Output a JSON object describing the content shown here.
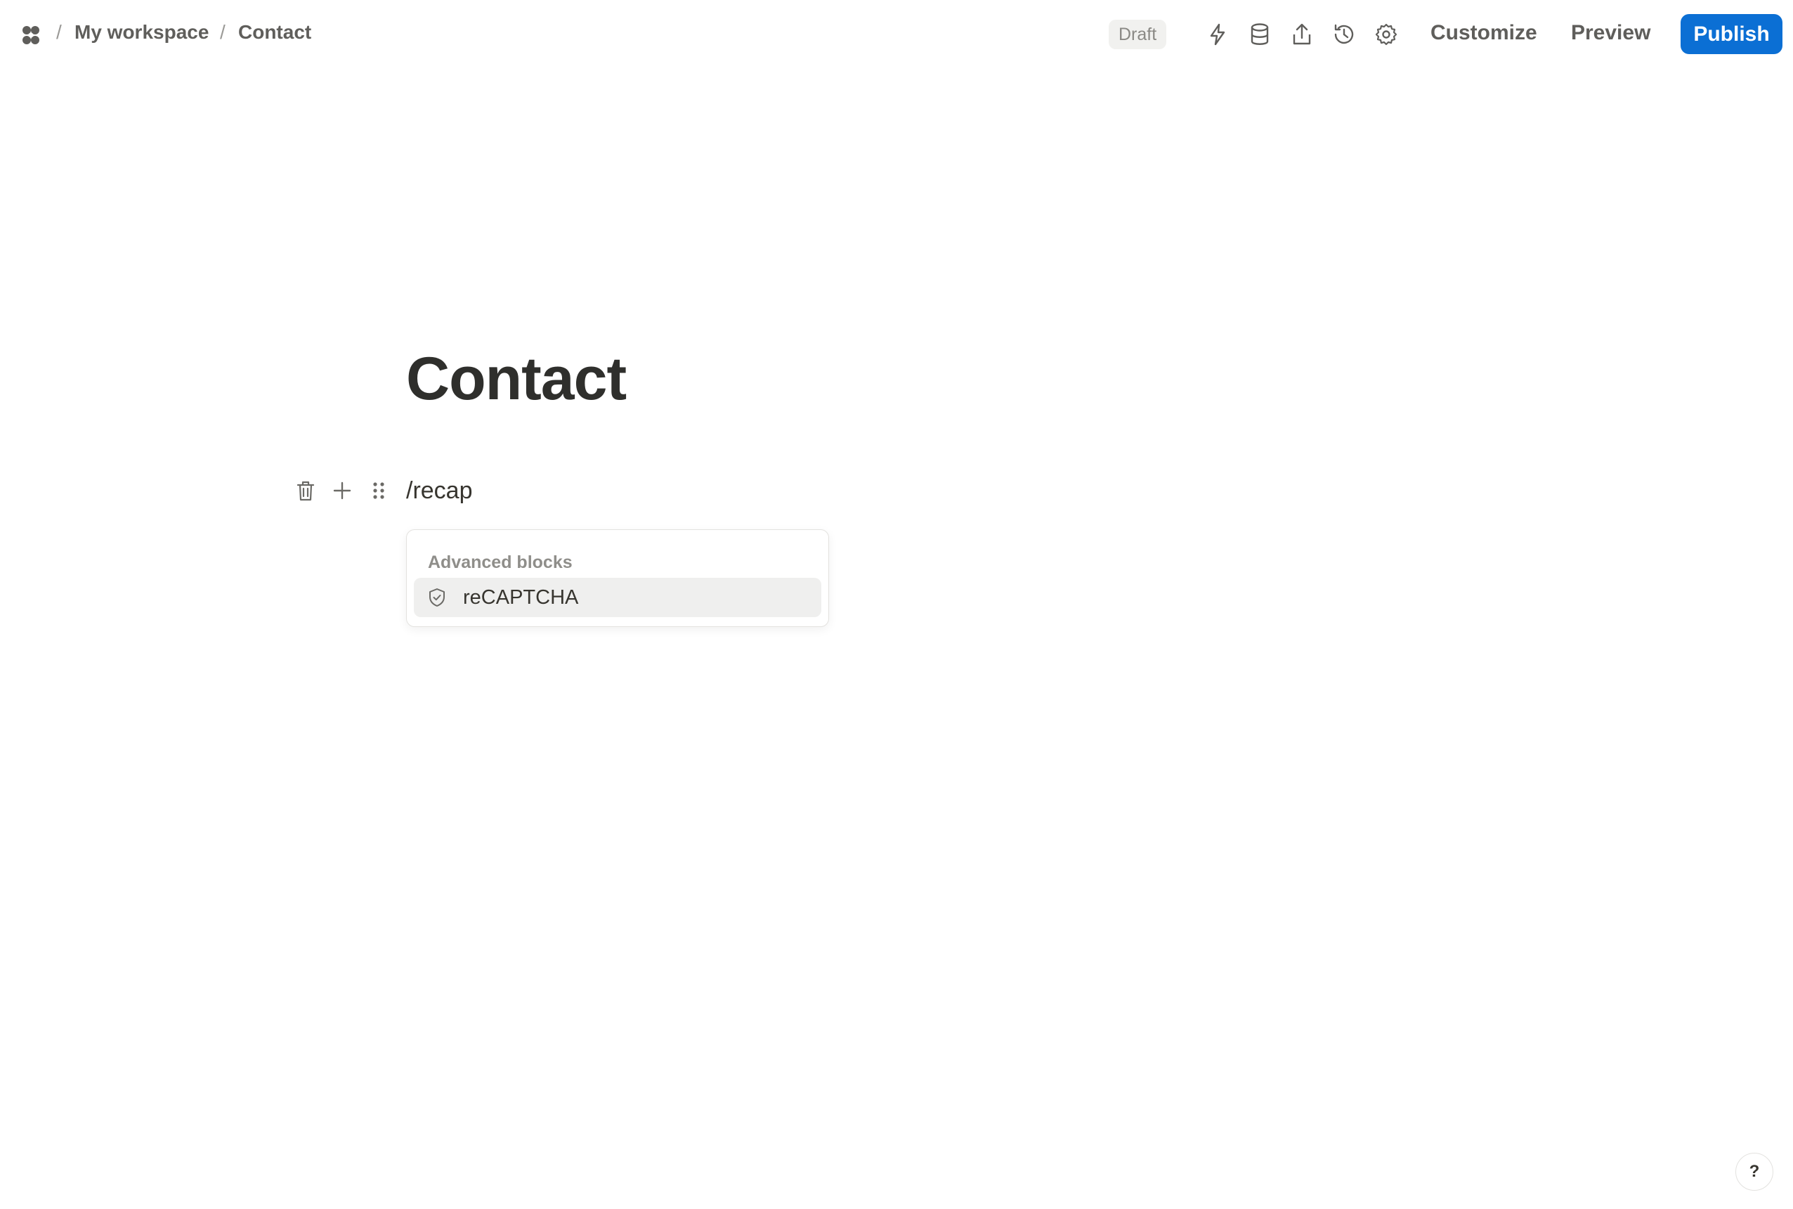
{
  "breadcrumb": {
    "separator": "/",
    "workspace": "My workspace",
    "page": "Contact"
  },
  "status": {
    "label": "Draft"
  },
  "toolbar": {
    "icons": [
      "lightning-icon",
      "database-icon",
      "share-icon",
      "history-icon",
      "settings-icon"
    ],
    "customize": "Customize",
    "preview": "Preview",
    "publish": "Publish"
  },
  "page": {
    "title": "Contact",
    "block_input": "/recap"
  },
  "block_tools": [
    "trash-icon",
    "plus-icon",
    "drag-handle-icon"
  ],
  "slash_menu": {
    "heading": "Advanced blocks",
    "items": [
      {
        "label": "reCAPTCHA",
        "icon": "shield-check-icon"
      }
    ]
  },
  "help": {
    "label": "?"
  },
  "colors": {
    "accent": "#0b6fd4",
    "text": "#37352f",
    "muted": "#8f8e8a",
    "highlight": "#efefee"
  }
}
